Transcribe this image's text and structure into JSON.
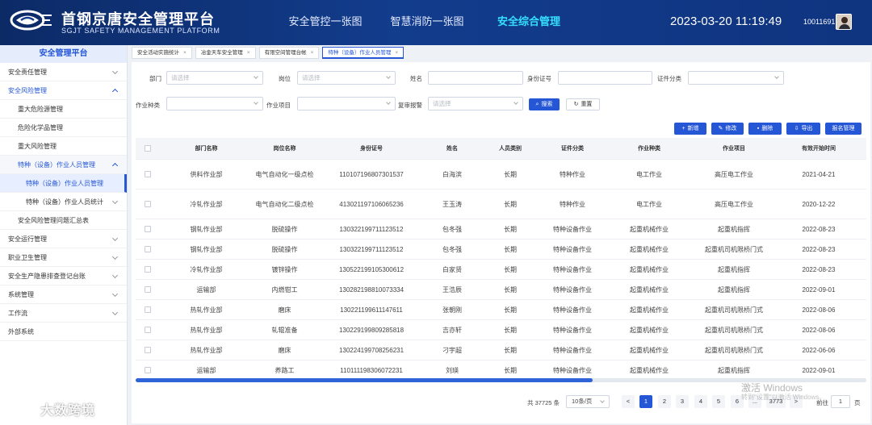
{
  "header": {
    "brand_title": "首钢京唐安全管理平台",
    "brand_subtitle": "SGJT SAFETY MANAGEMENT PLATFORM",
    "nav": [
      "安全管控一张图",
      "智慧消防一张图",
      "安全综合管理"
    ],
    "active_nav": "安全综合管理",
    "datetime": "2023-03-20 11:19:49",
    "user_id": "10011691"
  },
  "sidebar": {
    "title": "安全管理平台",
    "items": [
      {
        "label": "安全责任管理",
        "level": 1,
        "chevron": "down"
      },
      {
        "label": "安全风险管理",
        "level": 1,
        "chevron": "up",
        "state": "open"
      },
      {
        "label": "重大危险源管理",
        "level": 2
      },
      {
        "label": "危险化学品管理",
        "level": 2
      },
      {
        "label": "重大风险管理",
        "level": 2
      },
      {
        "label": "特种（设备）作业人员管理",
        "level": 2,
        "chevron": "up",
        "state": "open"
      },
      {
        "label": "特种（设备）作业人员管理",
        "level": 3,
        "state": "current"
      },
      {
        "label": "特种（设备）作业人员统计",
        "level": 3,
        "chevron": "down"
      },
      {
        "label": "安全风险管理问题汇总表",
        "level": 2
      },
      {
        "label": "安全运行管理",
        "level": 1,
        "chevron": "down"
      },
      {
        "label": "职业卫生管理",
        "level": 1,
        "chevron": "down"
      },
      {
        "label": "安全生产隐患排查登记台账",
        "level": 1,
        "chevron": "down"
      },
      {
        "label": "系统管理",
        "level": 1,
        "chevron": "down"
      },
      {
        "label": "工作流",
        "level": 1,
        "chevron": "down"
      },
      {
        "label": "外部系统",
        "level": 1
      }
    ]
  },
  "tabs": [
    {
      "label": "安全活动实施统计",
      "close": "×"
    },
    {
      "label": "冶金天车安全管理",
      "close": "×"
    },
    {
      "label": "有限空间管理台帐",
      "close": "×"
    },
    {
      "label": "特种（设备）作业人员管理",
      "close": "×",
      "active": true
    }
  ],
  "filters": {
    "dept_label": "部门",
    "dept_placeholder": "请选择",
    "post_label": "岗位",
    "post_placeholder": "请选择",
    "name_label": "姓名",
    "idno_label": "身份证号",
    "cert_label": "证件分类",
    "worktype_label": "作业种类",
    "workitem_label": "作业项目",
    "review_label": "复审报警",
    "review_placeholder": "请选择",
    "search_btn": "搜索",
    "reset_btn": "重置"
  },
  "actions": {
    "add": "新增",
    "edit": "修改",
    "delete": "删除",
    "export": "导出",
    "report": "报名管理"
  },
  "table": {
    "columns": [
      "部门名称",
      "岗位名称",
      "身份证号",
      "姓名",
      "人员类别",
      "证件分类",
      "作业种类",
      "作业项目",
      "有效开始时间"
    ],
    "rows": [
      [
        "供料作业部",
        "电气自动化一级点检",
        "110107196807301537",
        "白海滨",
        "长期",
        "特种作业",
        "电工作业",
        "高压电工作业",
        "2021-04-21"
      ],
      [
        "冷轧作业部",
        "电气自动化二级点检",
        "413021197106065236",
        "王玉涛",
        "长期",
        "特种作业",
        "电工作业",
        "高压电工作业",
        "2020-12-22"
      ],
      [
        "钢轧作业部",
        "脱硫操作",
        "130322199711123512",
        "包冬强",
        "长期",
        "特种设备作业",
        "起重机械作业",
        "起重机指挥",
        "2022-08-23"
      ],
      [
        "钢轧作业部",
        "脱硫操作",
        "130322199711123512",
        "包冬强",
        "长期",
        "特种设备作业",
        "起重机械作业",
        "起重机司机限桥门式",
        "2022-08-23"
      ],
      [
        "冷轧作业部",
        "镀锌操作",
        "130522199105300612",
        "白家贤",
        "长期",
        "特种设备作业",
        "起重机械作业",
        "起重机指挥",
        "2022-08-23"
      ],
      [
        "运输部",
        "内燃钳工",
        "130282198810073334",
        "王浩辰",
        "长期",
        "特种设备作业",
        "起重机械作业",
        "起重机指挥",
        "2022-09-01"
      ],
      [
        "热轧作业部",
        "磨床",
        "130221199611147611",
        "张朝刚",
        "长期",
        "特种设备作业",
        "起重机械作业",
        "起重机司机限桥门式",
        "2022-08-06"
      ],
      [
        "热轧作业部",
        "轧辊准备",
        "130229199809285818",
        "吉亦轩",
        "长期",
        "特种设备作业",
        "起重机械作业",
        "起重机司机限桥门式",
        "2022-08-06"
      ],
      [
        "热轧作业部",
        "磨床",
        "130224199708256231",
        "刁宇超",
        "长期",
        "特种设备作业",
        "起重机械作业",
        "起重机司机限桥门式",
        "2022-06-06"
      ],
      [
        "运输部",
        "养路工",
        "110111198306072231",
        "刘瑛",
        "长期",
        "特种设备作业",
        "起重机械作业",
        "起重机指挥",
        "2022-09-01"
      ]
    ]
  },
  "pagination": {
    "total_text": "共 37725 条",
    "page_size": "10条/页",
    "prev": "<",
    "pages": [
      "1",
      "2",
      "3",
      "4",
      "5",
      "6",
      "...",
      "3773"
    ],
    "current": "1",
    "next": ">",
    "goto_label": "前往",
    "goto_value": "1",
    "goto_unit": "页"
  },
  "overlay": {
    "watermark_line1": "激活 Windows",
    "watermark_line2": "转到\"设置\"以激活 Windows。",
    "corner_brand": "大数跨境"
  },
  "icons": {
    "search": "search-icon",
    "refresh": "refresh-icon",
    "plus": "plus-icon",
    "edit": "edit-icon",
    "delete": "trash-icon",
    "export": "export-icon"
  },
  "colors": {
    "header_bg": "#0f3480",
    "accent": "#2456d6",
    "active_nav": "#35e0ff"
  }
}
